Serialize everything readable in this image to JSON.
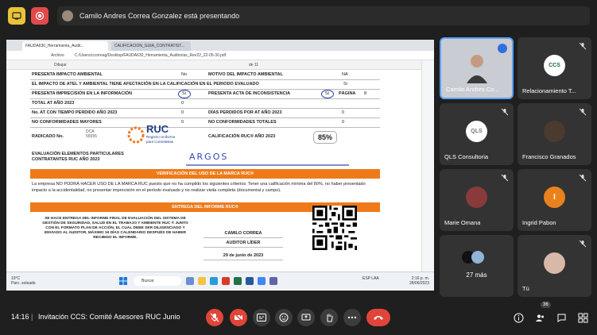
{
  "presenter_banner": "Camilo Andres Correa Gonzalez está presentando",
  "browser": {
    "tab_active": "FAUDA630_Herramienta_Audit...",
    "tab_inactive": "CALIFICACION_GUIA_CONTRATIST...",
    "file_label": "Archivo",
    "path": "C:/Users/ccorreag/Desktop/FAUDA630_Herramienta_Auditorias_Rev22_22-05-30.pdf",
    "draw_label": "Dibujar",
    "page_counter": "de 11"
  },
  "doc": {
    "rows": [
      {
        "l": "PRESENTA IMPACTO AMBIENTAL",
        "lv": "No",
        "r": "MOTIVO DEL IMPACTO AMBIENTAL",
        "rv": "NA"
      },
      {
        "l": "EL IMPACTO DE ATEL Y AMBIENTAL TIENE AFECTACIÓN EN LA CALIFICACIÓN EN EL PERIODO EVALUADO",
        "lv": "",
        "r": "",
        "rv": "Si"
      },
      {
        "l": "PRESENTA IMPRECISIÓN EN LA INFORMACIÓN",
        "lv": "Si",
        "r": "PRESENTA ACTA DE INCONSISTENCIA",
        "rv": "Si",
        "extra": "PÁGINA",
        "extrav": "8"
      },
      {
        "l": "TOTAL AT AÑO 2023",
        "lv": "0",
        "r": "",
        "rv": ""
      },
      {
        "l": "No. AT CON TIEMPO PERDIDO AÑO 2023",
        "lv": "0",
        "r": "DÍAS PERDIDOS POR AT AÑO 2023",
        "rv": "0"
      },
      {
        "l": "NO CONFORMIDADES MAYORES",
        "lv": "0",
        "r": "NO CONFORMIDADES TOTALES",
        "rv": "0"
      }
    ],
    "radicado_label": "RADICADO No.",
    "dca": "DCA",
    "dca_num": "55555",
    "ruc_logo": "RUC",
    "ruc_sub1": "Registro Uniforme",
    "ruc_sub2": "para Contratistas",
    "calif_label": "CALIFICACIÓN RUC® AÑO 2023",
    "calif_value": "85%",
    "eval_label": "EVALUACIÓN ELEMENTOS PARTICULARES CONTRATANTES RUC AÑO 2023",
    "eval_value": "ARGOS",
    "verif_header": "VERIFICACIÓN DEL USO DE LA MARCA RUC®",
    "verif_text": "La empresa NO PODRÁ HACER USO DE LA MARCA RUC puesto que no ha cumplido los siguientes criterios: Tener una calificación mínima del 80%, no haber presentado impacto a la accidentalidad, no presentar imprecisión en el periodo evaluado y no realizar visita completa (documental y campo).",
    "entrega_header": "ENTREGA DEL INFORME RUC®",
    "entrega_text": "SE HACE ENTREGA DEL INFORME FINAL DE EVALUACIÓN DEL SISTEMA DE GESTIÓN DE SEGURIDAD, SALUD EN EL TRABAJO Y AMBIENTE RUC ® JUNTO CON EL FORMATO PLAN DE ACCIÓN, EL CUAL DEBE SER DILIGENCIADO Y ENVIADO AL AUDITOR, MÁXIMO 16 DÍAS CALENDARIO DESPUÉS DE HABER RECIBIDO EL INFORME.",
    "signer_name": "CAMILO CORREA",
    "signer_role": "AUDITOR LÍDER",
    "signer_date": "29 de junio de 2023"
  },
  "taskbar": {
    "weather_temp": "19°C",
    "weather_desc": "Parc. soleado",
    "search": "Buscar",
    "lang": "ESP LAA",
    "time": "2:16 p. m.",
    "date": "28/06/2023"
  },
  "participants": [
    {
      "name": "Camilo Andres Co...",
      "kind": "camera"
    },
    {
      "name": "Relacionamiento T...",
      "kind": "logo",
      "logo": "CCS"
    },
    {
      "name": "QLS Consultoria",
      "kind": "logo",
      "logo": "QLS"
    },
    {
      "name": "Francisco Granados",
      "kind": "photo"
    },
    {
      "name": "Marie Omana",
      "kind": "photo"
    },
    {
      "name": "Ingrid Pabon",
      "kind": "initial",
      "initial": "I"
    },
    {
      "name": "27 más",
      "kind": "more"
    },
    {
      "name": "Tú",
      "kind": "photo"
    }
  ],
  "meeting": {
    "time": "14:16",
    "title": "Invitación CCS: Comité Asesores RUC Junio",
    "participant_count": "36"
  },
  "colors": {
    "accent_orange": "#ef7a1a",
    "ink_blue": "#2a3fa0",
    "red": "#e0453a",
    "speaking_blue": "#2f6fe0"
  }
}
